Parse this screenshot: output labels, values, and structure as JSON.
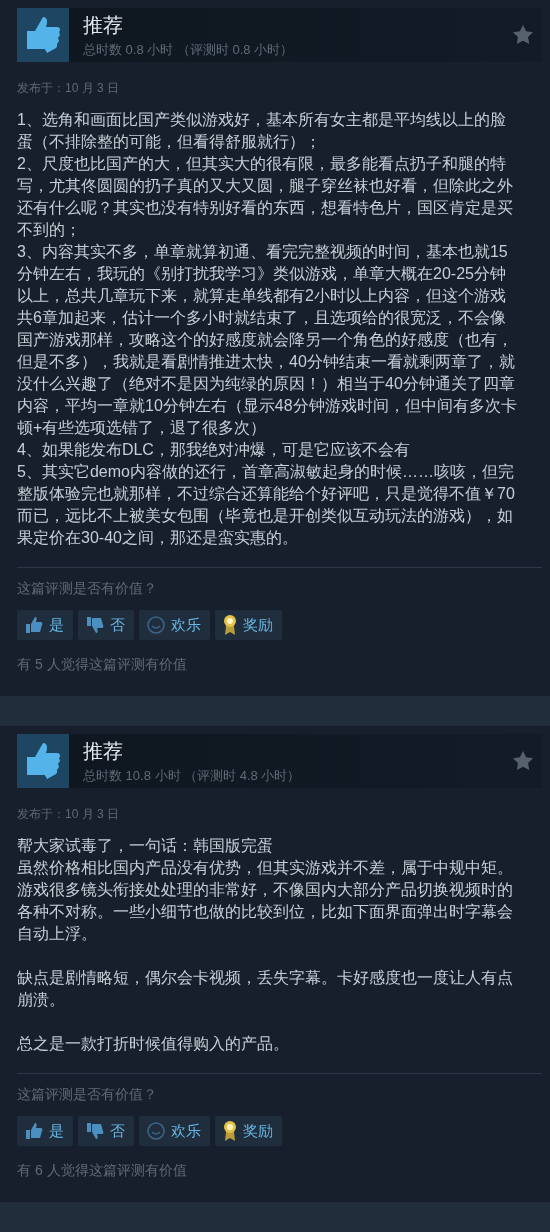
{
  "reviews": [
    {
      "verdict": "推荐",
      "hours": "总时数 0.8 小时 （评测时 0.8 小时）",
      "recommended": true,
      "posted": "发布于：10 月 3 日",
      "sections": [
        [
          "1、选角和画面比国产类似游戏好，基本所有女主都是平均线以上的脸蛋（不排除整的可能，但看得舒服就行）；",
          "2、尺度也比国产的大，但其实大的很有限，最多能看点扔子和腿的特写，尤其佟圆圆的扔子真的又大又圆，腿子穿丝袜也好看，但除此之外还有什么呢？其实也没有特别好看的东西，想看特色片，国区肯定是买不到的；",
          "3、内容其实不多，单章就算初通、看完完整视频的时间，基本也就15分钟左右，我玩的《别打扰我学习》类似游戏，单章大概在20-25分钟以上，总共几章玩下来，就算走单线都有2小时以上内容，但这个游戏共6章加起来，估计一个多小时就结束了，且选项给的很宽泛，不会像国产游戏那样，攻略这个的好感度就会降另一个角色的好感度（也有，但是不多），我就是看剧情推进太快，40分钟结束一看就剩两章了，就没什么兴趣了（绝对不是因为纯绿的原因！）相当于40分钟通关了四章内容，平均一章就10分钟左右（显示48分钟游戏时间，但中间有多次卡顿+有些选项选错了，退了很多次）",
          "4、如果能发布DLC，那我绝对冲爆，可是它应该不会有",
          "5、其实它demo内容做的还行，首章高淑敏起身的时候……咳咳，但完整版体验完也就那样，不过综合还算能给个好评吧，只是觉得不值￥70而已，远比不上被美女包围（毕竟也是开创类似互动玩法的游戏），如果定价在30-40之间，那还是蛮实惠的。"
        ]
      ],
      "question": "这篇评测是否有价值？",
      "buttons": [
        {
          "kind": "thumb-up",
          "label": "是"
        },
        {
          "kind": "thumb-down",
          "label": "否"
        },
        {
          "kind": "smile",
          "label": "欢乐"
        },
        {
          "kind": "award",
          "label": "奖励"
        }
      ],
      "helpful": "有 5 人觉得这篇评测有价值"
    },
    {
      "verdict": "推荐",
      "hours": "总时数 10.8 小时 （评测时 4.8 小时）",
      "recommended": true,
      "posted": "发布于：10 月 3 日",
      "sections": [
        [
          "帮大家试毒了，一句话：韩国版完蛋",
          "虽然价格相比国内产品没有优势，但其实游戏并不差，属于中规中矩。",
          "游戏很多镜头衔接处处理的非常好，不像国内大部分产品切换视频时的各种不对称。一些小细节也做的比较到位，比如下面界面弹出时字幕会自动上浮。"
        ],
        [
          "缺点是剧情略短，偶尔会卡视频，丢失字幕。卡好感度也一度让人有点崩溃。"
        ],
        [
          "总之是一款打折时候值得购入的产品。"
        ]
      ],
      "question": "这篇评测是否有价值？",
      "buttons": [
        {
          "kind": "thumb-up",
          "label": "是"
        },
        {
          "kind": "thumb-down",
          "label": "否"
        },
        {
          "kind": "smile",
          "label": "欢乐"
        },
        {
          "kind": "award",
          "label": "奖励"
        }
      ],
      "helpful": "有 6 人觉得这篇评测有价值"
    }
  ]
}
